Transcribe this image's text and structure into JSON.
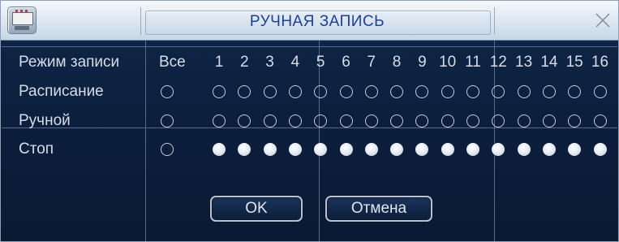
{
  "window": {
    "title": "РУЧНАЯ ЗАПИСЬ"
  },
  "grid": {
    "header_label": "Режим записи",
    "all_label": "Все",
    "channels": [
      "1",
      "2",
      "3",
      "4",
      "5",
      "6",
      "7",
      "8",
      "9",
      "10",
      "11",
      "12",
      "13",
      "14",
      "15",
      "16"
    ],
    "rows": [
      {
        "label": "Расписание",
        "all_selected": false,
        "channels_selected": [
          false,
          false,
          false,
          false,
          false,
          false,
          false,
          false,
          false,
          false,
          false,
          false,
          false,
          false,
          false,
          false
        ]
      },
      {
        "label": "Ручной",
        "all_selected": false,
        "channels_selected": [
          false,
          false,
          false,
          false,
          false,
          false,
          false,
          false,
          false,
          false,
          false,
          false,
          false,
          false,
          false,
          false
        ]
      },
      {
        "label": "Стоп",
        "all_selected": false,
        "channels_selected": [
          true,
          true,
          true,
          true,
          true,
          true,
          true,
          true,
          true,
          true,
          true,
          true,
          true,
          true,
          true,
          true
        ]
      }
    ]
  },
  "buttons": {
    "ok_label": "OK",
    "cancel_label": "Отмена"
  },
  "icons": {
    "app": "dvr-monitor-icon",
    "close": "close-icon"
  },
  "colors": {
    "background": "#0b1e3c",
    "title_text": "#1d3f97",
    "text": "#d6dde8"
  }
}
